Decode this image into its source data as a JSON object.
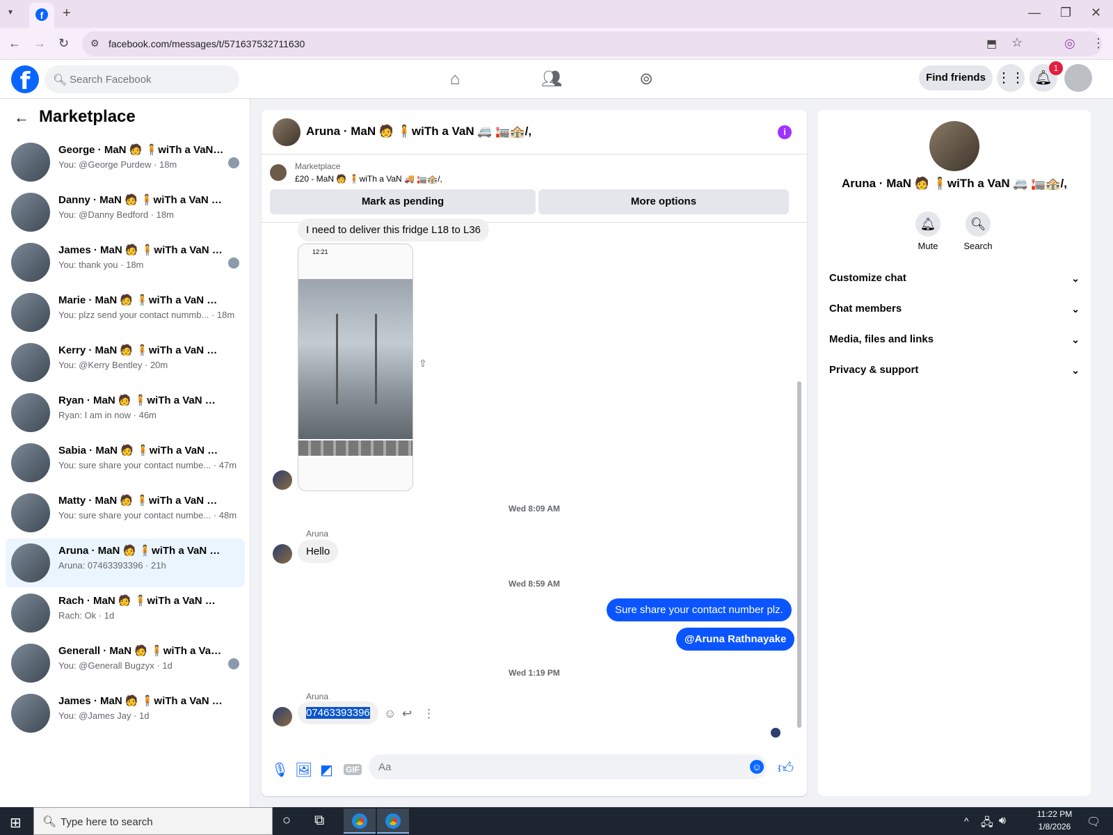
{
  "browser": {
    "url": "facebook.com/messages/t/571637532711630"
  },
  "header": {
    "search_placeholder": "Search Facebook",
    "find_friends": "Find friends",
    "notification_count": "1"
  },
  "sidebar": {
    "title": "Marketplace",
    "conversations": [
      {
        "name": "George · MaN 🧑 🧍wiTh a VaN 🚐 🏣🏤/,",
        "snippet": "You: @George Purdew · 18m"
      },
      {
        "name": "Danny · MaN 🧑 🧍wiTh a VaN 🚐 🏣🏤/,",
        "snippet": "You: @Danny Bedford · 18m"
      },
      {
        "name": "James · MaN 🧑 🧍wiTh a VaN 🚐 🏣🏤/,",
        "snippet": "You: thank you · 18m"
      },
      {
        "name": "Marie · MaN 🧑 🧍wiTh a VaN 🚐 🏣🏤/,",
        "snippet": "You: plzz send your contact nummb... · 18m"
      },
      {
        "name": "Kerry · MaN 🧑 🧍wiTh a VaN 🚐 🏣🏤/,",
        "snippet": "You: @Kerry Bentley · 20m"
      },
      {
        "name": "Ryan · MaN 🧑 🧍wiTh a VaN 🚐 🏣🏤/,",
        "snippet": "Ryan: I am in now · 46m"
      },
      {
        "name": "Sabia · MaN 🧑 🧍wiTh a VaN 🚐 🏣🏤/,",
        "snippet": "You: sure share your contact numbe... · 47m"
      },
      {
        "name": "Matty · MaN 🧑 🧍wiTh a VaN 🚐 🏣🏤/,",
        "snippet": "You: sure share your contact numbe... · 48m"
      },
      {
        "name": "Aruna · MaN 🧑 🧍wiTh a VaN 🚐 🏣🏤/,",
        "snippet": "Aruna: 07463393396 · 21h"
      },
      {
        "name": "Rach · MaN 🧑 🧍wiTh a VaN 🚐 🏣🏤/,",
        "snippet": "Rach: Ok · 1d"
      },
      {
        "name": "Generall · MaN 🧑 🧍wiTh a VaN 🚐 🏣🏤/,",
        "snippet": "You: @Generall Bugzyx · 1d"
      },
      {
        "name": "James · MaN 🧑 🧍wiTh a VaN 🚐 🏣🏤/,",
        "snippet": "You: @James Jay · 1d"
      }
    ]
  },
  "chat": {
    "title": "Aruna · MaN 🧑 🧍wiTh a VaN 🚐 🏣🏤/,",
    "marketplace_label": "Marketplace",
    "listing": "£20 - MaN 🧑 🧍wiTh a VaN 🚚 🏣🏤/,",
    "mark_pending": "Mark as pending",
    "more_options": "More options",
    "first_message": "I need to deliver this fridge L18 to L36",
    "photo_time": "12:21",
    "ts1": "Wed 8:09 AM",
    "sender1": "Aruna",
    "hello": "Hello",
    "ts2": "Wed 8:59 AM",
    "out1": "Sure share your contact number plz.",
    "out2": "@Aruna Rathnayake",
    "ts3": "Wed 1:19 PM",
    "sender2": "Aruna",
    "phone": "07463393396",
    "composer_placeholder": "Aa",
    "gif_label": "GIF"
  },
  "info_panel": {
    "name": "Aruna · MaN 🧑 🧍wiTh a VaN 🚐 🏣🏤/,",
    "mute": "Mute",
    "search": "Search",
    "sections": [
      "Customize chat",
      "Chat members",
      "Media, files and links",
      "Privacy & support"
    ]
  },
  "taskbar": {
    "search_placeholder": "Type here to search",
    "time": "11:22 PM",
    "date": "1/8/2026"
  },
  "colors": {
    "fb_blue": "#0866ff",
    "outgoing_bubble": "#0a55ff",
    "active_conversation": "#ebf5ff",
    "info_icon": "#a033ff"
  }
}
